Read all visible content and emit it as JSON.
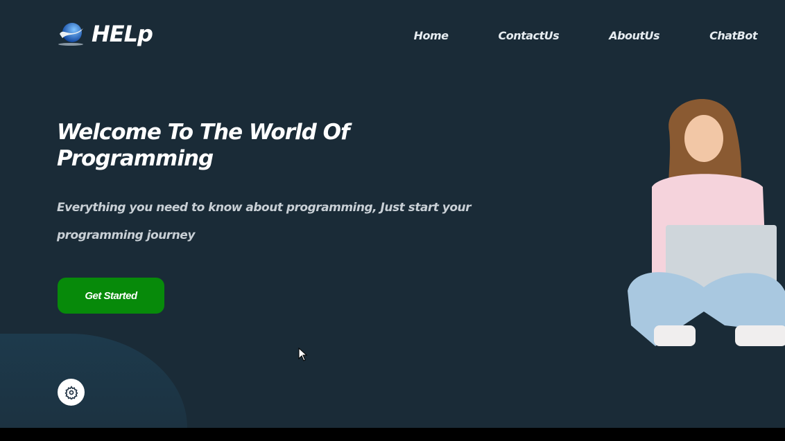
{
  "brand": {
    "name": "HELp",
    "logo_icon": "globe-swoosh-icon"
  },
  "nav": {
    "items": [
      {
        "label": "Home"
      },
      {
        "label": "ContactUs"
      },
      {
        "label": "AboutUs"
      },
      {
        "label": "ChatBot"
      }
    ]
  },
  "hero": {
    "title": "Welcome To The World Of Programming",
    "subtitle": "Everything you need to know about programming, Just start your programming journey",
    "cta_label": "Get Started",
    "image": "woman-with-laptop-illustration"
  },
  "settings": {
    "icon": "gear-icon"
  },
  "colors": {
    "background": "#1a2b37",
    "cta": "#078a0a",
    "text": "#ffffff"
  }
}
